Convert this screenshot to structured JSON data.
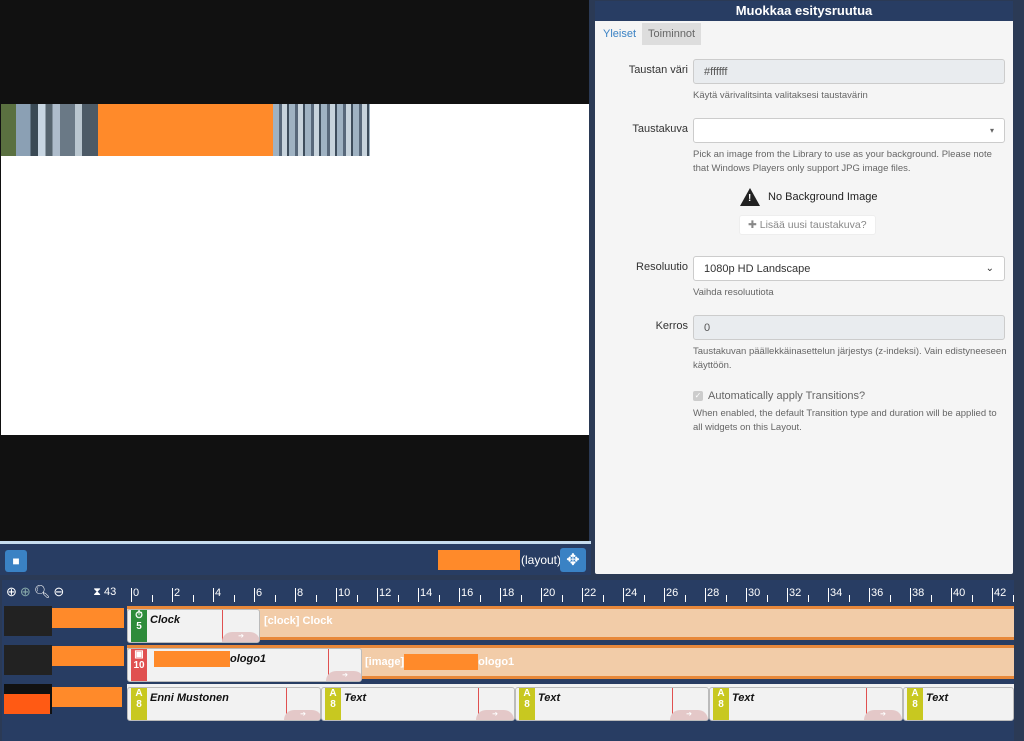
{
  "viewer": {
    "layout_suffix": "(layout)"
  },
  "panel": {
    "title": "Muokkaa esitysruutua",
    "tabs": [
      {
        "label": "Yleiset",
        "active": true
      },
      {
        "label": "Toiminnot",
        "active": false
      }
    ],
    "background_color": {
      "label": "Taustan väri",
      "value": "#ffffff",
      "help": "Käytä värivalitsinta valitaksesi taustavärin"
    },
    "background_image": {
      "label": "Taustakuva",
      "value": "",
      "help": "Pick an image from the Library to use as your background. Please note that Windows Players only support JPG image files.",
      "no_image_text": "No Background Image",
      "add_button": "Lisää uusi taustakuva?"
    },
    "resolution": {
      "label": "Resoluutio",
      "value": "1080p HD Landscape",
      "help": "Vaihda resoluutiota"
    },
    "layer": {
      "label": "Kerros",
      "value": "0",
      "help": "Taustakuvan päällekkäinasettelun järjestys (z-indeksi). Vain edistyneeseen käyttöön."
    },
    "transitions": {
      "label": "Automatically apply Transitions?",
      "checked": true,
      "help": "When enabled, the default Transition type and duration will be applied to all widgets on this Layout."
    }
  },
  "timeline": {
    "duration": "43",
    "ticks": [
      "0",
      "2",
      "4",
      "6",
      "8",
      "10",
      "12",
      "14",
      "16",
      "18",
      "20",
      "22",
      "24",
      "26",
      "28",
      "30",
      "32",
      "34",
      "36",
      "38",
      "40",
      "42"
    ],
    "rows": [
      {
        "widgets": [
          {
            "title": "Clock",
            "badge": "5",
            "color": "#2e8b3a"
          }
        ],
        "ghost": "[clock] Clock"
      },
      {
        "widgets": [
          {
            "title": "ologo1",
            "badge": "10",
            "color": "#e05050"
          }
        ],
        "ghost": "[image]",
        "ghost_suffix": "ologo1"
      },
      {
        "widgets": [
          {
            "title": "Enni Mustonen",
            "badge": "8",
            "color": "#c8c820"
          },
          {
            "title": "Text",
            "badge": "8",
            "color": "#c8c820"
          },
          {
            "title": "Text",
            "badge": "8",
            "color": "#c8c820"
          },
          {
            "title": "Text",
            "badge": "8",
            "color": "#c8c820"
          },
          {
            "title": "Text",
            "badge": "8",
            "color": "#c8c820"
          }
        ]
      }
    ]
  }
}
